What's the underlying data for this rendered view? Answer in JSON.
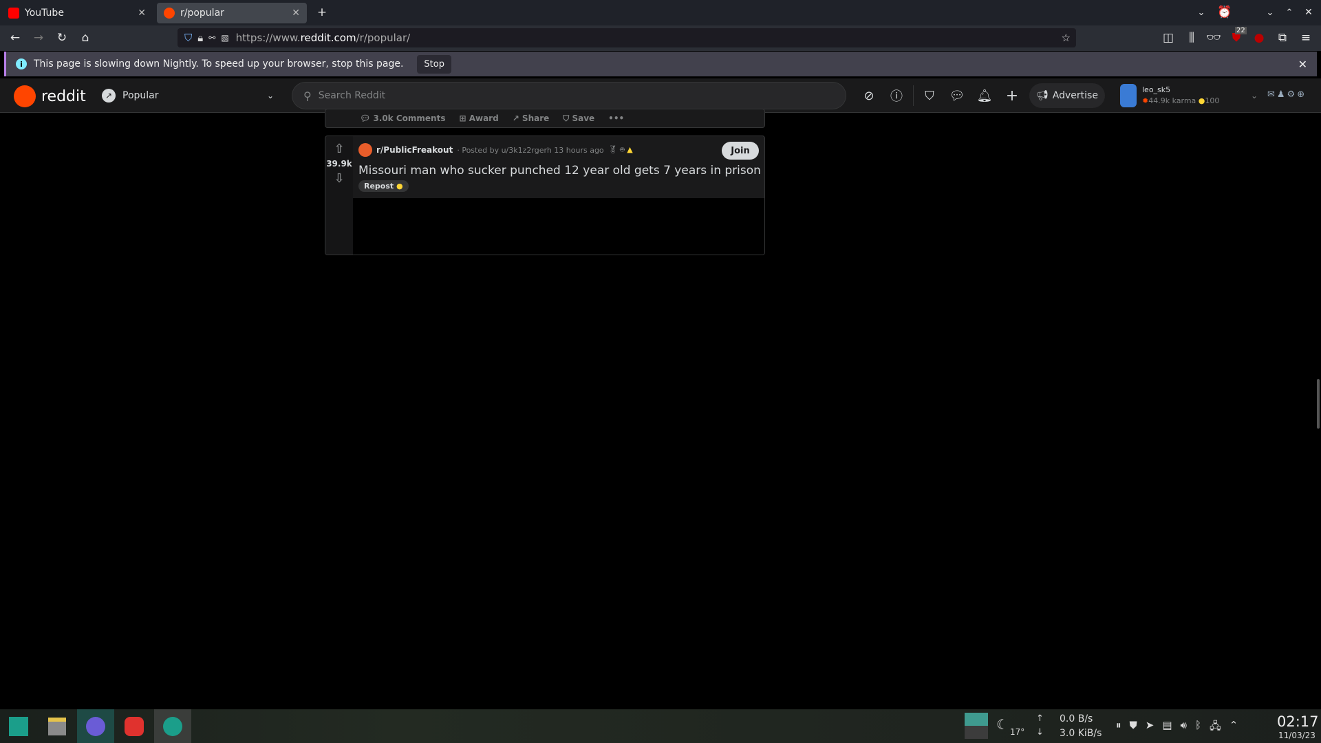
{
  "browser": {
    "tabs": [
      {
        "label": "YouTube",
        "icon": "youtube-icon",
        "active": false
      },
      {
        "label": "r/popular",
        "icon": "reddit-icon",
        "active": true
      }
    ],
    "url_prefix": "https://www.",
    "url_domain": "reddit.com",
    "url_path": "/r/popular/",
    "extension_badge": "22",
    "notification": {
      "text": "This page is slowing down Nightly. To speed up your browser, stop this page.",
      "stop_label": "Stop"
    }
  },
  "reddit": {
    "logo_text": "reddit",
    "feed": "Popular",
    "search_placeholder": "Search Reddit",
    "advertise_label": "Advertise",
    "user": {
      "name": "leo_sk5",
      "karma": "44.9k karma",
      "coins": "100"
    },
    "prev_actions": {
      "comments": "3.0k Comments",
      "award": "Award",
      "share": "Share",
      "save": "Save"
    },
    "post": {
      "subreddit": "r/PublicFreakout",
      "posted_by": "· Posted by u/3k1z2rgerh 13 hours ago",
      "votes": "39.9k",
      "title": "Missouri man who sucker punched 12 year old gets 7 years in prison",
      "flair": "Repost",
      "join_label": "Join"
    }
  },
  "taskbar": {
    "weather": "17°",
    "upload": "0.0 B/s",
    "download": "3.0 KiB/s",
    "time": "02:17",
    "date": "11/03/23"
  },
  "colors": {
    "reddit_orange": "#ff4500",
    "accent": "#1b9e8a"
  }
}
